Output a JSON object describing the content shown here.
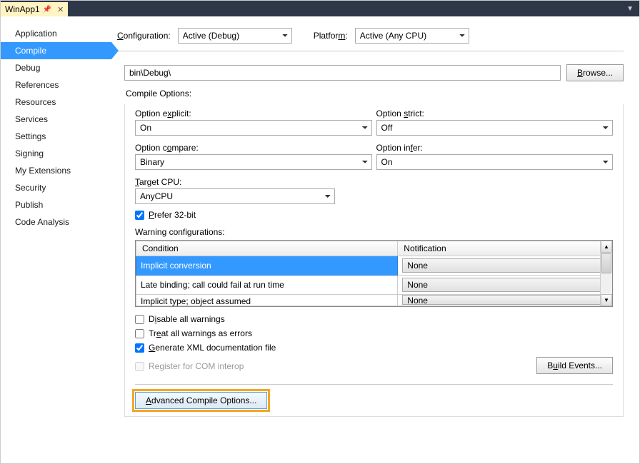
{
  "tab": {
    "title": "WinApp1"
  },
  "sidebar": {
    "items": [
      "Application",
      "Compile",
      "Debug",
      "References",
      "Resources",
      "Services",
      "Settings",
      "Signing",
      "My Extensions",
      "Security",
      "Publish",
      "Code Analysis"
    ],
    "active_index": 1
  },
  "top": {
    "config_label": "Configuration:",
    "config_value": "Active (Debug)",
    "platform_label": "Platform:",
    "platform_value": "Active (Any CPU)"
  },
  "output": {
    "path": "bin\\Debug\\",
    "browse": "Browse..."
  },
  "compile": {
    "title": "Compile Options:",
    "option_explicit_label": "Option explicit:",
    "option_explicit": "On",
    "option_strict_label": "Option strict:",
    "option_strict": "Off",
    "option_compare_label": "Option compare:",
    "option_compare": "Binary",
    "option_infer_label": "Option infer:",
    "option_infer": "On",
    "target_cpu_label": "Target CPU:",
    "target_cpu": "AnyCPU",
    "prefer32_label": "Prefer 32-bit",
    "prefer32_checked": true,
    "warn_cfg_label": "Warning configurations:",
    "table": {
      "col1": "Condition",
      "col2": "Notification",
      "rows": [
        {
          "cond": "Implicit conversion",
          "notif": "None"
        },
        {
          "cond": "Late binding; call could fail at run time",
          "notif": "None"
        },
        {
          "cond": "Implicit type; object assumed",
          "notif": "None"
        }
      ]
    },
    "disable_all": "Disable all warnings",
    "treat_errors": "Treat all warnings as errors",
    "gen_xml": "Generate XML documentation file",
    "gen_xml_checked": true,
    "register_com": "Register for COM interop",
    "build_events": "Build Events...",
    "advanced": "Advanced Compile Options..."
  }
}
